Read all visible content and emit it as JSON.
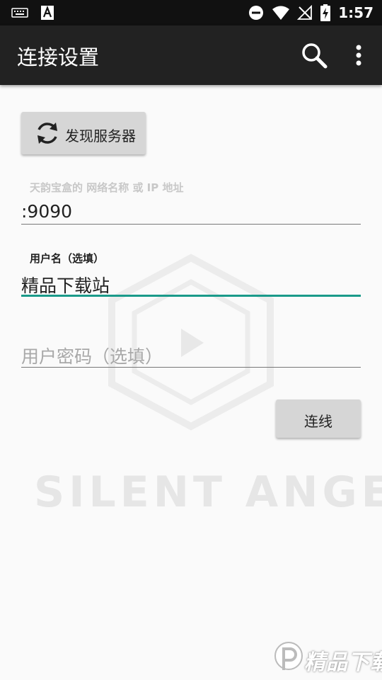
{
  "status_bar": {
    "time": "1:57",
    "icons": [
      "keyboard-icon",
      "text-a-icon",
      "do-not-disturb-icon",
      "wifi-icon",
      "no-signal-icon",
      "battery-charging-icon"
    ]
  },
  "app_bar": {
    "title": "连接设置",
    "actions": [
      "search-icon",
      "more-vert-icon"
    ]
  },
  "discover_button": {
    "label": "发现服务器",
    "icon": "refresh-icon"
  },
  "server_field": {
    "label": "天韵宝盒的 网络名称 或 IP 地址",
    "value": ":9090"
  },
  "username_field": {
    "label": "用户名（选填）",
    "value": "精品下载站"
  },
  "password_field": {
    "placeholder": "用户密码（选填）"
  },
  "connect_button": {
    "label": "连线"
  },
  "watermark": {
    "text": "SILENT ANGEL"
  },
  "corner_badge": {
    "text": "精品下载"
  },
  "colors": {
    "app_bar": "#222222",
    "accent": "#1a9a8a",
    "background": "#fafafa",
    "button": "#d6d6d6"
  }
}
